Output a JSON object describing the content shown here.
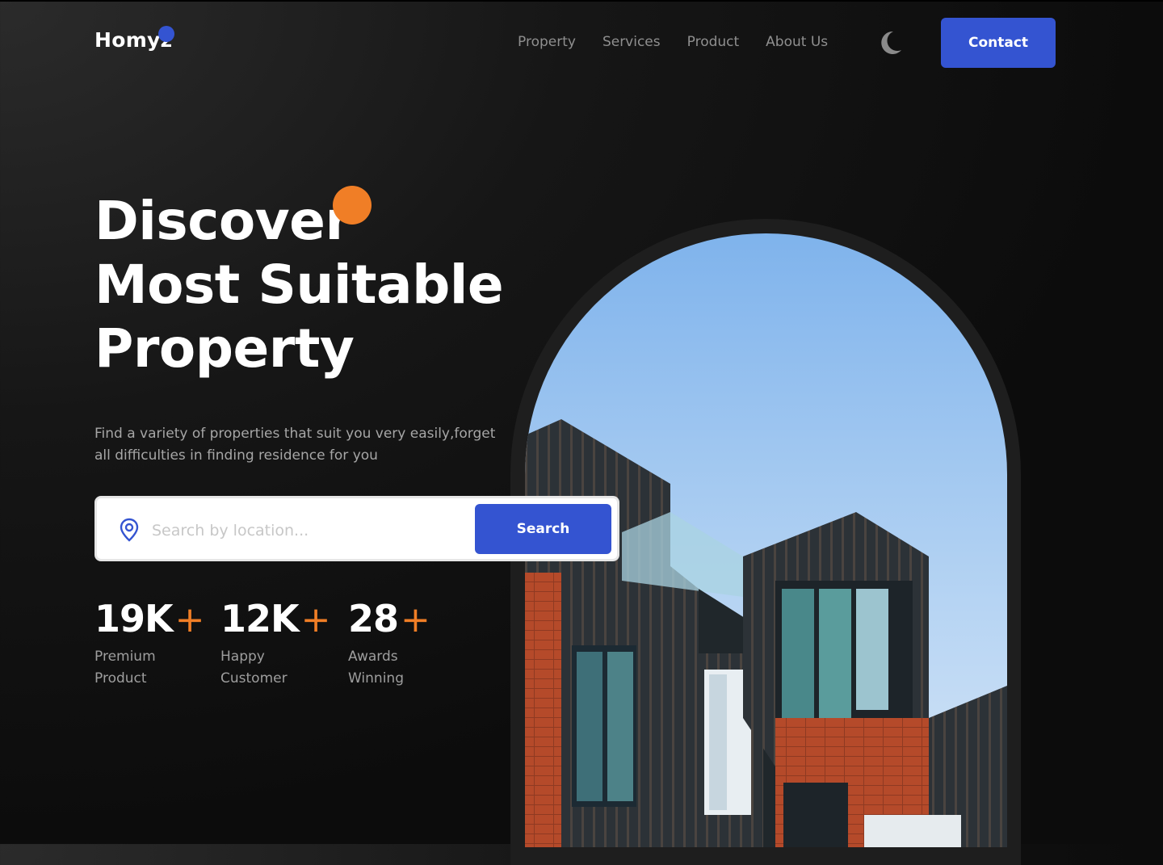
{
  "header": {
    "logo": "Homyz",
    "nav": [
      "Property",
      "Services",
      "Product",
      "About Us"
    ],
    "theme_icon": "moon-icon",
    "contact_label": "Contact"
  },
  "hero": {
    "title_lines": [
      "Discover",
      "Most Suitable",
      "Property"
    ],
    "description": "Find a variety of properties that suit you very easily,forget all difficulties in finding residence for you"
  },
  "search": {
    "icon": "location-pin-icon",
    "placeholder": "Search by location...",
    "value": "",
    "button_label": "Search"
  },
  "stats": [
    {
      "number": "19K",
      "suffix": "+",
      "label": "Premium Product"
    },
    {
      "number": "12K",
      "suffix": "+",
      "label": "Happy Customer"
    },
    {
      "number": "28",
      "suffix": "+",
      "label": "Awards Winning"
    }
  ],
  "colors": {
    "accent_blue": "#3454d1",
    "accent_orange": "#f07e26",
    "background": "#111111"
  }
}
